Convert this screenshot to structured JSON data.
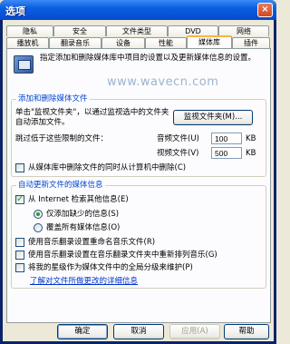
{
  "window": {
    "title": "选项",
    "close_glyph": "×"
  },
  "tabs": {
    "row_back": [
      "隐私",
      "安全",
      "文件类型",
      "DVD",
      "网络"
    ],
    "row_front": [
      "播放机",
      "翻录音乐",
      "设备",
      "性能",
      "媒体库",
      "插件"
    ],
    "active": "媒体库"
  },
  "panel": {
    "description": "指定添加和删除媒体库中项目的设置以及更新媒体信息的设置。",
    "watermark": "www.wavecn.com",
    "add_group": {
      "legend": "添加和删除媒体文件",
      "monitor_text": "单击\"监视文件夹\"，以通过监视选中的文件夹自动添加文件。",
      "monitor_button": "监视文件夹(M)...",
      "skip_label": "跳过低于这些限制的文件：",
      "audio_label": "音频文件(U)",
      "audio_value": "100",
      "audio_unit": "KB",
      "video_label": "视频文件(V)",
      "video_value": "500",
      "video_unit": "KB",
      "delete_checkbox": "从媒体库中删除文件的同时从计算机中删除(C)",
      "delete_checked": false
    },
    "update_group": {
      "legend": "自动更新文件的媒体信息",
      "internet_checkbox": "从 Internet 检索其他信息(E)",
      "internet_checked": true,
      "radio_missing": "仅添加缺少的信息(S)",
      "radio_missing_checked": true,
      "radio_overwrite": "覆盖所有媒体信息(O)",
      "radio_overwrite_checked": false,
      "rename_checkbox": "使用音乐翻录设置重命名音乐文件(R)",
      "rename_checked": false,
      "rearrange_checkbox": "使用音乐翻录设置在音乐翻录文件夹中重新排列音乐(G)",
      "rearrange_checked": false,
      "rating_checkbox": "将我的星级作为媒体文件中的全局分级来维护(P)",
      "rating_checked": false,
      "details_link": "了解对文件所做更改的详细信息"
    }
  },
  "buttons": {
    "ok": "确定",
    "cancel": "取消",
    "apply": "应用(A)",
    "help": "帮助"
  }
}
